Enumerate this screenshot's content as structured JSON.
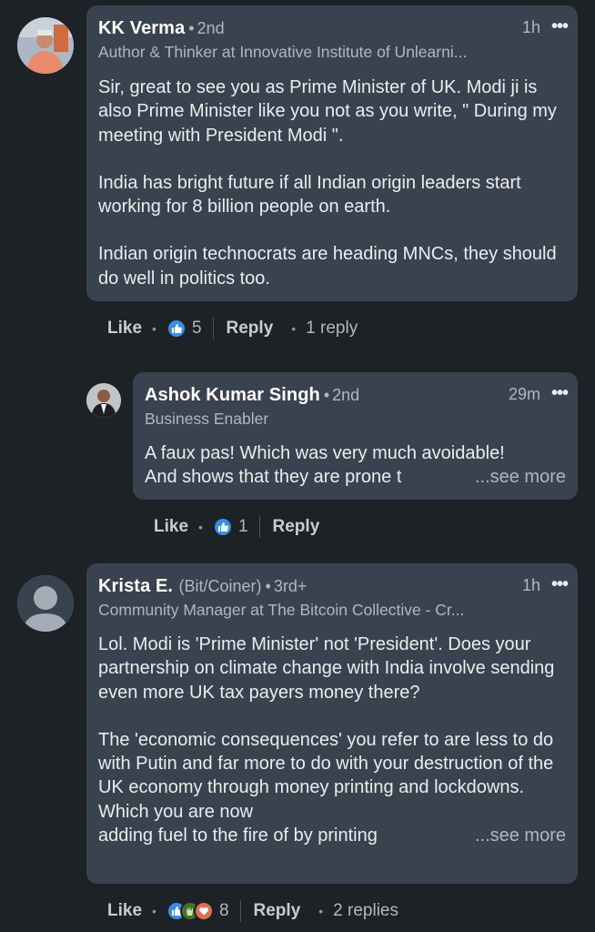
{
  "comments": [
    {
      "name": "KK Verma",
      "degree": "2nd",
      "time": "1h",
      "headline": "Author & Thinker at Innovative Institute of Unlearni...",
      "paragraphs": [
        "Sir, great to see you as Prime Minister of UK. Modi ji is also Prime Minister like you not as you write, \" During my meeting with President Modi \".",
        "India has bright future if all Indian origin leaders start working for 8 billion people on earth.",
        "Indian origin technocrats are heading MNCs, they should do well in politics too."
      ],
      "like_label": "Like",
      "reaction_count": "5",
      "reply_label": "Reply",
      "replies": "1 reply"
    },
    {
      "name": "Ashok Kumar Singh",
      "degree": "2nd",
      "time": "29m",
      "headline": "Business Enabler",
      "line1": "A faux pas! Which was very much avoidable!",
      "line2": "And shows that they are prone t",
      "see_more": "...see more",
      "like_label": "Like",
      "reaction_count": "1",
      "reply_label": "Reply"
    },
    {
      "name": "Krista E.",
      "name_suffix": "(Bit/Coiner)",
      "degree": "3rd+",
      "time": "1h",
      "headline": "Community Manager at The Bitcoin Collective - Cr...",
      "paragraph1": "Lol. Modi is 'Prime Minister' not 'President'. Does your partnership on climate change with India involve sending even more UK tax payers money there?",
      "paragraph2_main": "The 'economic consequences' you refer to are less to do with Putin and far more to do with your destruction of the UK economy through money printing and lockdowns. Which you are now",
      "paragraph2_last": "adding fuel to the fire of by printing",
      "see_more": "...see more",
      "like_label": "Like",
      "reaction_count": "8",
      "reply_label": "Reply",
      "replies": "2 replies"
    }
  ],
  "ui": {
    "separator_dot": "•",
    "more_icon": "•••",
    "colors": {
      "background": "#1d2226",
      "bubble": "#38434f",
      "like": "#378fe9",
      "clap": "#44712e",
      "love": "#df704d"
    }
  }
}
